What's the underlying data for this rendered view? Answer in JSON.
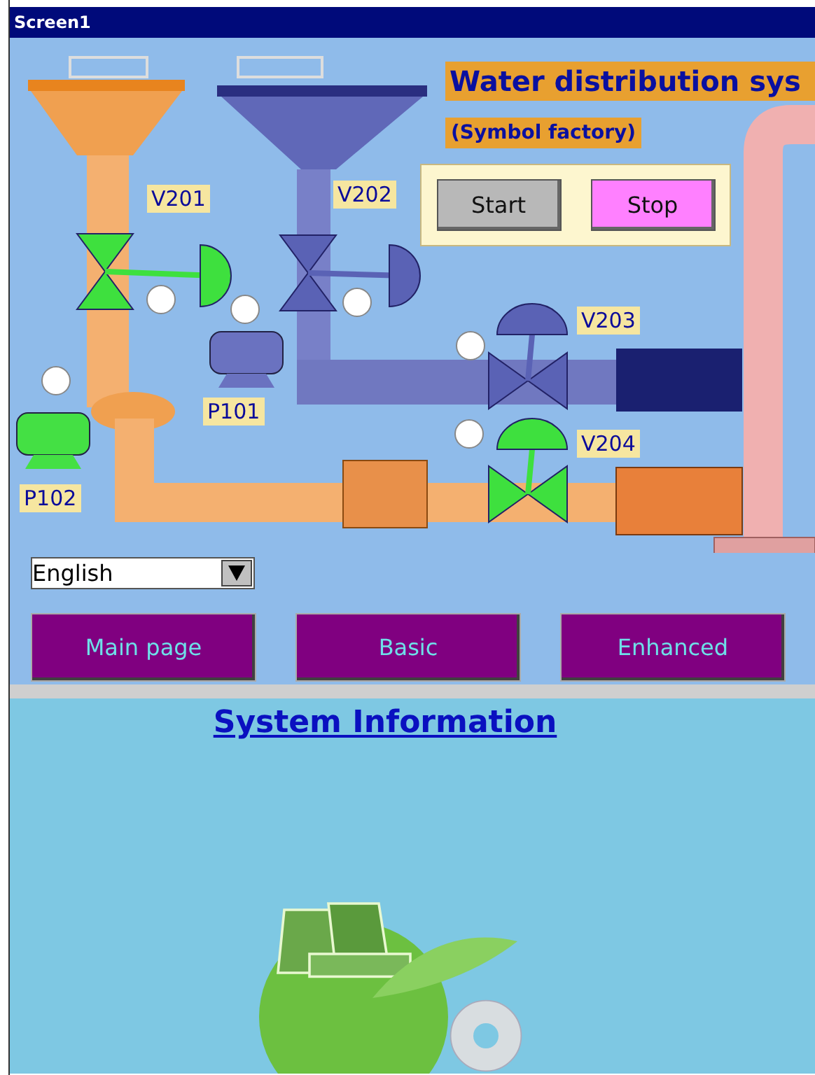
{
  "window": {
    "title": "Screen1"
  },
  "header": {
    "title": "Water distribution sys",
    "subtitle": "(Symbol factory)"
  },
  "controls": [
    {
      "label": "Start",
      "kind": "start"
    },
    {
      "label": "Stop",
      "kind": "stop"
    }
  ],
  "valves": [
    {
      "label": "V201",
      "open": true
    },
    {
      "label": "V202",
      "open": false
    },
    {
      "label": "V203",
      "open": false
    },
    {
      "label": "V204",
      "open": true
    }
  ],
  "pumps": [
    {
      "label": "P101",
      "running": false
    },
    {
      "label": "P102",
      "running": true
    }
  ],
  "language": {
    "value": "English"
  },
  "nav": [
    "Main page",
    "Basic",
    "Enhanced"
  ],
  "link": "System Information"
}
